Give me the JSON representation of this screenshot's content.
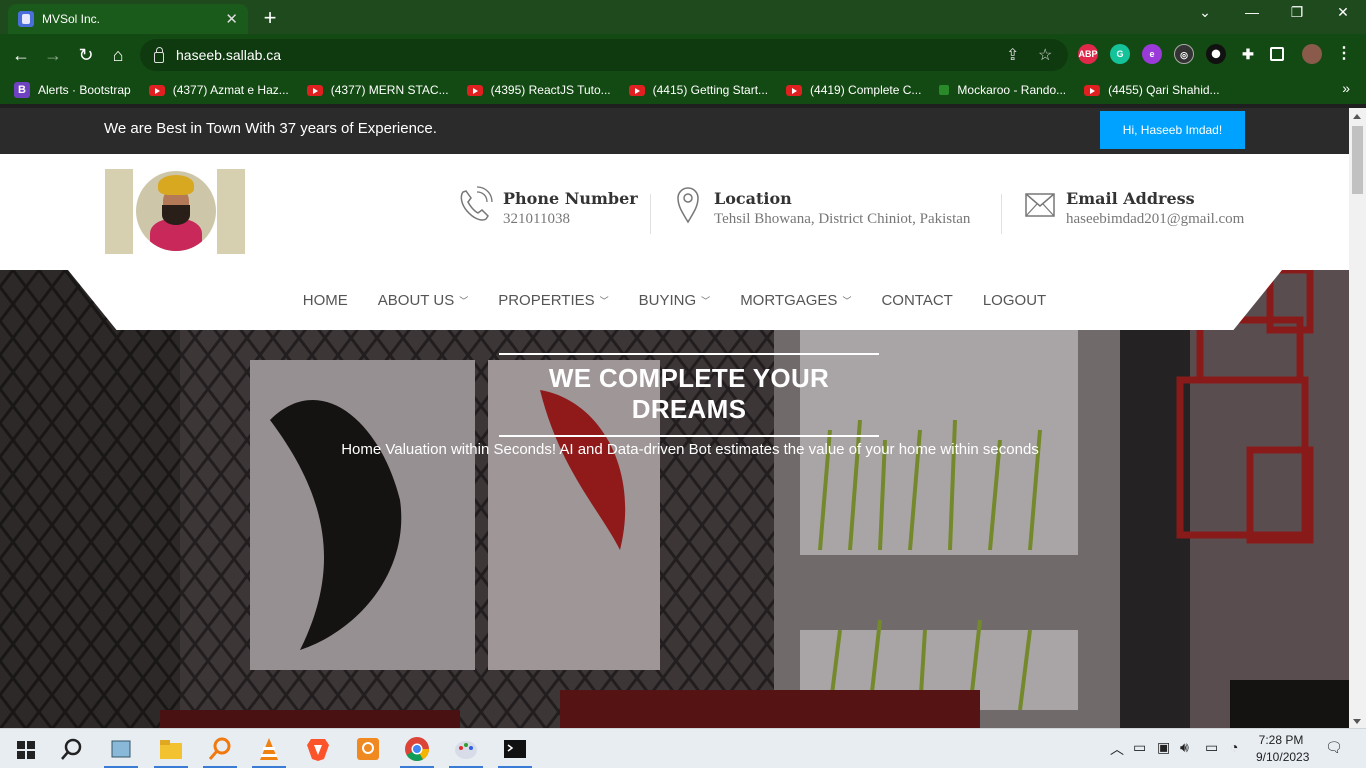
{
  "browser": {
    "tab_title": "MVSol Inc.",
    "tab_close": "✕",
    "new_tab": "+",
    "url": "haseeb.sallab.ca",
    "window_controls": [
      "⌄",
      "—",
      "❐",
      "✕"
    ],
    "extensions": [
      "ABP",
      "G",
      "e",
      "◎",
      "github",
      "puzzle",
      "sidebar",
      "profile"
    ]
  },
  "bookmarks": [
    {
      "label": "Alerts · Bootstrap",
      "icon": "bootstrap-icon"
    },
    {
      "label": "(4377) Azmat e Haz...",
      "icon": "youtube-icon"
    },
    {
      "label": "(4377) MERN STAC...",
      "icon": "youtube-icon"
    },
    {
      "label": "(4395) ReactJS Tuto...",
      "icon": "youtube-icon"
    },
    {
      "label": "(4415) Getting Start...",
      "icon": "youtube-icon"
    },
    {
      "label": "(4419) Complete C...",
      "icon": "youtube-icon"
    },
    {
      "label": "Mockaroo - Rando...",
      "icon": "mockaroo-icon"
    },
    {
      "label": "(4455) Qari Shahid...",
      "icon": "youtube-icon"
    }
  ],
  "site": {
    "tagline": "We are Best in Town With 37 years of Experience.",
    "greeting_button": "Hi, Haseeb Imdad!",
    "contacts": {
      "phone": {
        "label": "Phone Number",
        "value": "321011038"
      },
      "location": {
        "label": "Location",
        "value": "Tehsil Bhowana, District Chiniot, Pakistan"
      },
      "email": {
        "label": "Email Address",
        "value": "haseebimdad201@gmail.com"
      }
    },
    "menu": {
      "home": "HOME",
      "about": "ABOUT US",
      "properties": "PROPERTIES",
      "buying": "BUYING",
      "mortgages": "MORTGAGES",
      "contact": "CONTACT",
      "logout": "LOGOUT"
    },
    "hero": {
      "title": "WE COMPLETE YOUR DREAMS",
      "subtitle": "Home Valuation within Seconds! AI and Data-driven Bot estimates the value of your home within seconds"
    }
  },
  "taskbar": {
    "time": "7:28 PM",
    "date": "9/10/2023"
  },
  "colors": {
    "accent_button": "#00a2ff",
    "top_strip": "#2b2b2b",
    "browser_frame": "#134a13"
  }
}
